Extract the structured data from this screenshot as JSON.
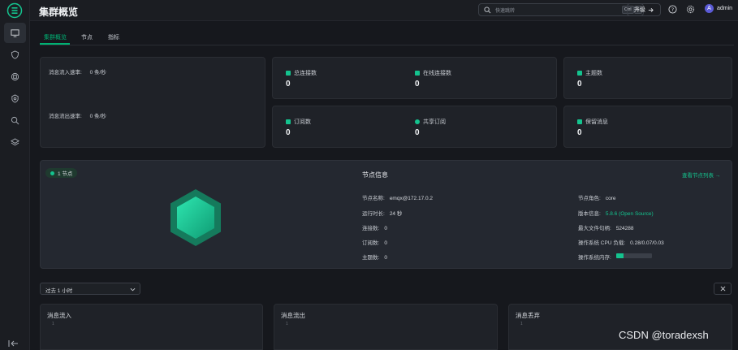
{
  "app": {
    "title": "集群概览"
  },
  "search": {
    "placeholder": "快速跳转",
    "kbd1": "Ctrl",
    "kbd2": "K"
  },
  "header": {
    "upgrade_label": "升级",
    "user": "admin",
    "avatar_letter": "A"
  },
  "tabs": [
    {
      "label": "集群概览"
    },
    {
      "label": "节点"
    },
    {
      "label": "指标"
    }
  ],
  "rates": {
    "in_label": "消息流入速率:",
    "in_value": "0 条/秒",
    "out_label": "消息流出速率:",
    "out_value": "0 条/秒"
  },
  "stats": {
    "total_conn": {
      "label": "总连接数",
      "value": "0"
    },
    "online_conn": {
      "label": "在线连接数",
      "value": "0"
    },
    "topics": {
      "label": "主题数",
      "value": "0"
    },
    "subscriptions": {
      "label": "订阅数",
      "value": "0"
    },
    "shared_subs": {
      "label": "共享订阅",
      "value": "0"
    },
    "retained": {
      "label": "保留消息",
      "value": "0"
    }
  },
  "node": {
    "badge": "1 节点",
    "title": "节点信息",
    "view_link": "查看节点列表 →",
    "left": [
      {
        "k": "节点名称:",
        "v": "emqx@172.17.0.2"
      },
      {
        "k": "运行时长:",
        "v": "24 秒"
      },
      {
        "k": "连接数:",
        "v": "0"
      },
      {
        "k": "订阅数:",
        "v": "0"
      },
      {
        "k": "主题数:",
        "v": "0"
      }
    ],
    "right": [
      {
        "k": "节点角色:",
        "v": "core"
      },
      {
        "k": "版本信息:",
        "v": "5.8.6 (Open Source)"
      },
      {
        "k": "最大文件句柄:",
        "v": "524288"
      },
      {
        "k": "操作系统 CPU 负载:",
        "v": "0.28/0.07/0.03"
      },
      {
        "k": "操作系统内存:",
        "v": ""
      }
    ],
    "memory_fraction": 0.2,
    "colors": {
      "accent": "#14c38e"
    }
  },
  "time_range": {
    "selected": "过去 1 小时"
  },
  "charts": [
    {
      "title": "消息流入",
      "tick": "1"
    },
    {
      "title": "消息流出",
      "tick": "1"
    },
    {
      "title": "消息丢弃",
      "tick": "1"
    }
  ],
  "watermark": "CSDN @toradexsh"
}
